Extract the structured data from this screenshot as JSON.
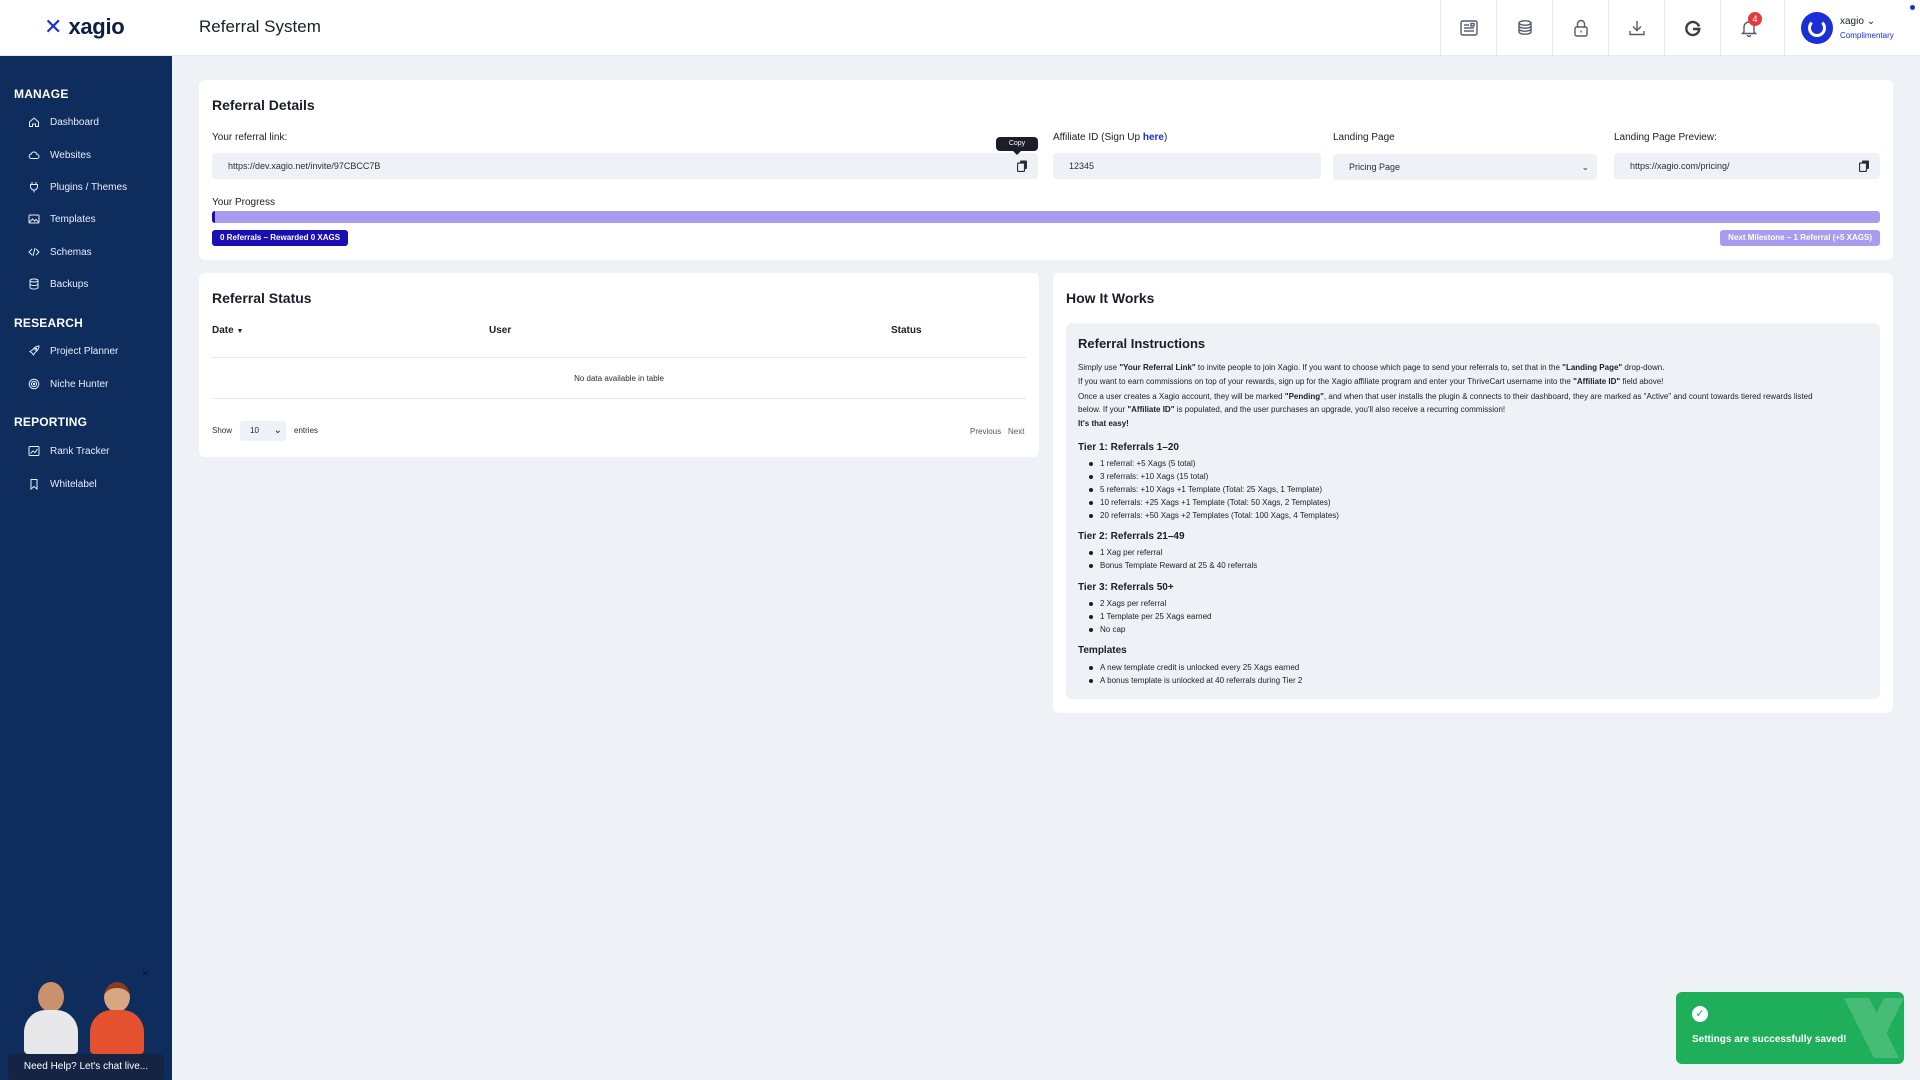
{
  "app": {
    "logo_text": "xagio",
    "page_title": "Referral System",
    "notification_count": "4",
    "user_name": "xagio",
    "user_plan": "Complimentary"
  },
  "sidebar": {
    "sections": [
      "MANAGE",
      "RESEARCH",
      "REPORTING"
    ],
    "items": [
      {
        "label": "Dashboard",
        "icon": "home-icon"
      },
      {
        "label": "Websites",
        "icon": "cloud-icon"
      },
      {
        "label": "Plugins / Themes",
        "icon": "plug-icon"
      },
      {
        "label": "Templates",
        "icon": "image-icon"
      },
      {
        "label": "Schemas",
        "icon": "code-icon"
      },
      {
        "label": "Backups",
        "icon": "database-icon"
      },
      {
        "label": "Project Planner",
        "icon": "rocket-icon"
      },
      {
        "label": "Niche Hunter",
        "icon": "target-icon"
      },
      {
        "label": "Rank Tracker",
        "icon": "chart-icon"
      },
      {
        "label": "Whitelabel",
        "icon": "bookmark-icon"
      }
    ],
    "chat_label": "Need Help? Let's chat live...",
    "chat_close": "×"
  },
  "referral_details": {
    "title": "Referral Details",
    "link_label": "Your referral link:",
    "link_value": "https://dev.xagio.net/invite/97CBCC7B",
    "copy_tooltip": "Copy",
    "affiliate_label": "Affiliate ID (Sign Up ",
    "affiliate_link": "here",
    "affiliate_label_end": ")",
    "affiliate_value": "12345",
    "landing_label": "Landing Page",
    "landing_value": "Pricing Page",
    "preview_label": "Landing Page Preview:",
    "preview_value": "https://xagio.com/pricing/",
    "progress_label": "Your Progress",
    "progress_fraction": 0.0,
    "progress_left_badge": "0 Referrals – Rewarded 0 XAGS",
    "progress_right_badge": "Next Milestone – 1 Referral (+5 XAGS)"
  },
  "referral_status": {
    "title": "Referral Status",
    "columns": [
      "Date",
      "User",
      "Status"
    ],
    "empty_text": "No data available in table",
    "show_label": "Show",
    "entries_value": "10",
    "entries_label": "entries",
    "prev_label": "Previous",
    "next_label": "Next"
  },
  "how_it_works": {
    "title": "How It Works",
    "instr_title": "Referral Instructions",
    "p1_a": "Simply use ",
    "p1_b": "\"Your Referral Link\"",
    "p1_c": " to invite people to join Xagio. If you want to choose which page to send your referrals to, set that in the ",
    "p1_d": "\"Landing Page\"",
    "p1_e": " drop-down.",
    "p2_a": "If you want to earn commissions on top of your rewards, sign up for the Xagio affiliate program and enter your ThriveCart username into the ",
    "p2_b": "\"Affiliate ID\"",
    "p2_c": " field above!",
    "p3_a": "Once a user creates a Xagio account, they will be marked ",
    "p3_b": "\"Pending\"",
    "p3_c": ", and when that user installs the plugin & connects to their dashboard, they are marked as \"Active\" and count towards tiered rewards listed",
    "p4_a": "below. If your ",
    "p4_b": "\"Affiliate ID\"",
    "p4_c": " is populated, and the user purchases an upgrade, you'll also receive a recurring commission!",
    "p5": "It's that easy!",
    "tier1_title": "Tier 1: Referrals 1–20",
    "tier1": [
      "1 referral: +5 Xags (5 total)",
      "3 referrals: +10 Xags (15 total)",
      "5 referrals: +10 Xags +1 Template (Total: 25 Xags, 1 Template)",
      "10 referrals: +25 Xags +1 Template (Total: 50 Xags, 2 Templates)",
      "20 referrals: +50 Xags +2 Templates (Total: 100 Xags, 4 Templates)"
    ],
    "tier2_title": "Tier 2: Referrals 21–49",
    "tier2": [
      "1 Xag per referral",
      "Bonus Template Reward at 25 & 40 referrals"
    ],
    "tier3_title": "Tier 3: Referrals 50+",
    "tier3": [
      "2 Xags per referral",
      "1 Template per 25 Xags earned",
      "No cap"
    ],
    "templates_title": "Templates",
    "templates": [
      "A new template credit is unlocked every 25 Xags earned",
      "A bonus template is unlocked at 40 referrals during Tier 2"
    ]
  },
  "toast": {
    "message": "Settings are successfully saved!",
    "icon": "check-icon"
  },
  "colors": {
    "brand": "#1a2fd6",
    "sidebar": "#0f2d5c",
    "progress_fill": "#1a0fb5",
    "progress_track": "#a99cf0",
    "toast": "#1fae5a",
    "badge": "#e23b3b"
  }
}
